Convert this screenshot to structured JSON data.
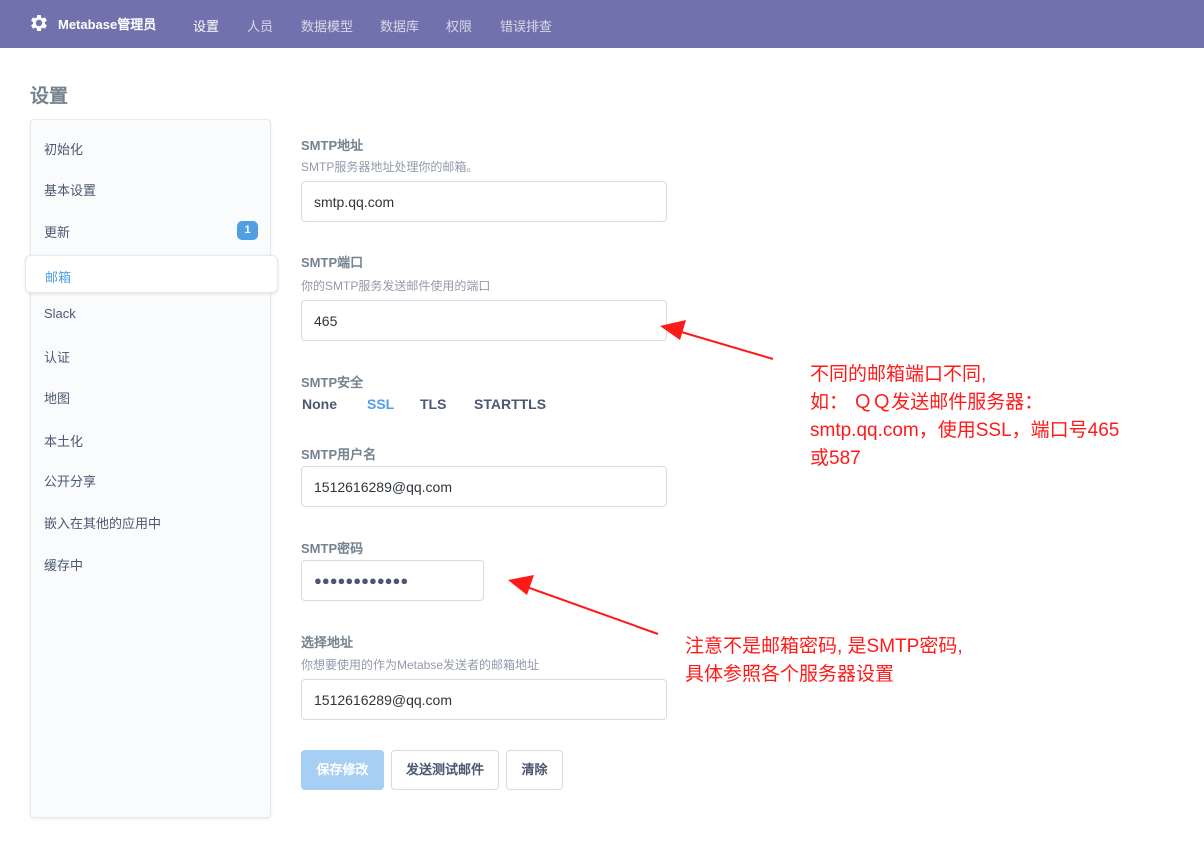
{
  "header": {
    "brand": "Metabase管理员",
    "nav": [
      "设置",
      "人员",
      "数据模型",
      "数据库",
      "权限",
      "错误排查"
    ]
  },
  "page": {
    "title": "设置"
  },
  "sidebar": {
    "items": [
      "初始化",
      "基本设置",
      "更新",
      "邮箱",
      "Slack",
      "认证",
      "地图",
      "本土化",
      "公开分享",
      "嵌入在其他的应用中",
      "缓存中"
    ],
    "update_badge": "1"
  },
  "form": {
    "smtp_host": {
      "label": "SMTP地址",
      "desc": "SMTP服务器地址处理你的邮箱。",
      "value": "smtp.qq.com"
    },
    "smtp_port": {
      "label": "SMTP端口",
      "desc": "你的SMTP服务发送邮件使用的端口",
      "value": "465"
    },
    "smtp_security": {
      "label": "SMTP安全",
      "options": [
        "None",
        "SSL",
        "TLS",
        "STARTTLS"
      ],
      "selected": "SSL"
    },
    "smtp_username": {
      "label": "SMTP用户名",
      "value": "1512616289@qq.com"
    },
    "smtp_password": {
      "label": "SMTP密码",
      "value": "●●●●●●●●●●●●"
    },
    "from_address": {
      "label": "选择地址",
      "desc": "你想要使用的作为Metabse发送者的邮箱地址",
      "value": "1512616289@qq.com"
    }
  },
  "buttons": {
    "save": "保存修改",
    "send_test": "发送测试邮件",
    "clear": "清除"
  },
  "annotations": {
    "port_note": [
      "不同的邮箱端口不同,",
      "如：  ＱＱ发送邮件服务器：",
      "smtp.qq.com，使用SSL，端口号465",
      "或587"
    ],
    "password_note": [
      "注意不是邮箱密码, 是SMTP密码,",
      "具体参照各个服务器设置"
    ]
  },
  "colors": {
    "nav_bg": "#7172ad",
    "accent": "#509ee3",
    "annotation": "#ff1a1a"
  }
}
